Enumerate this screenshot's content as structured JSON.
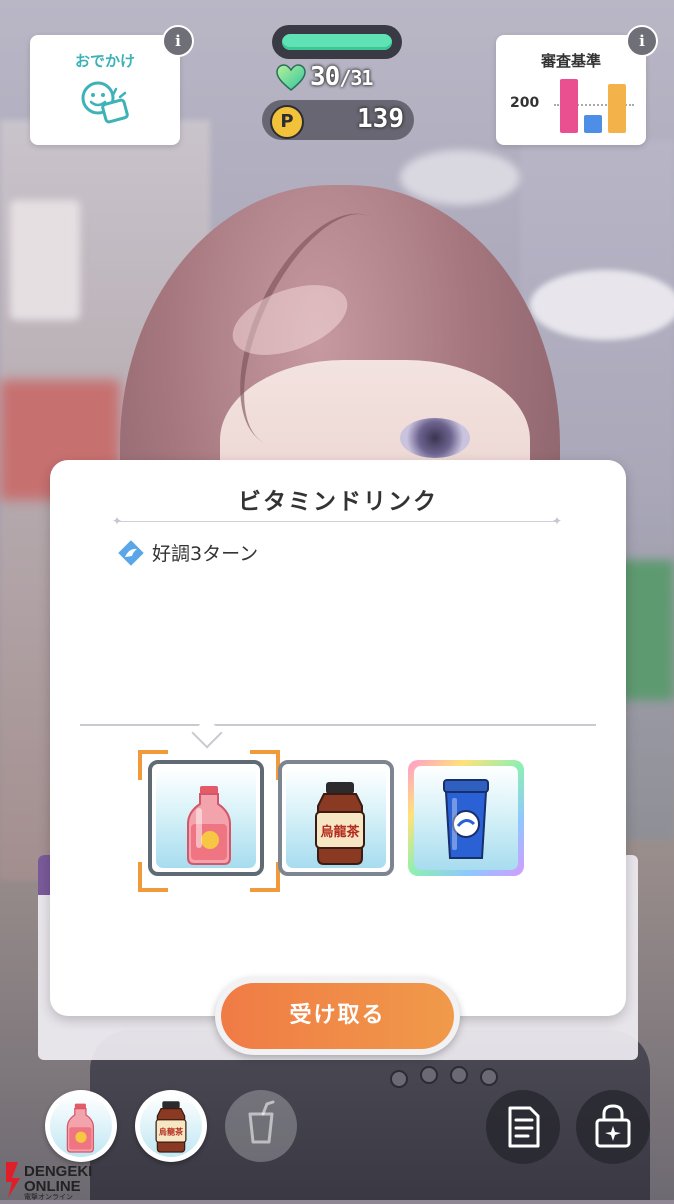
{
  "hud": {
    "outing_label": "おでかけ",
    "outing_icon": "smile-bag-icon",
    "stamina_fraction": 1.0,
    "hp_current": "30",
    "hp_max": "/31",
    "p_label": "P",
    "points": "139",
    "criteria_label": "審査基準",
    "criteria_value": "200",
    "criteria_bars": [
      {
        "value": 0.9,
        "color": "#ea4f8f"
      },
      {
        "value": 0.3,
        "color": "#4d8fe6"
      },
      {
        "value": 0.82,
        "color": "#f4b34a"
      }
    ],
    "info_glyph": "i"
  },
  "dialog": {
    "title": "ビタミンドリンク",
    "effect_icon": "good-condition-icon",
    "effect_text": "好調3ターン",
    "items": [
      {
        "name": "vitamin-drink",
        "icon": "pink-bottle-icon",
        "selected": true
      },
      {
        "name": "oolong-tea",
        "icon": "oolong-tea-bottle-icon",
        "selected": false,
        "label": "烏龍茶"
      },
      {
        "name": "protein-shaker",
        "icon": "blue-shaker-icon",
        "selected": false
      }
    ],
    "receive_label": "受け取る"
  },
  "bottom": {
    "slots": [
      "pink-bottle-icon",
      "oolong-tea-bottle-icon",
      "empty-cup-icon"
    ],
    "slot_tea_label": "烏龍茶",
    "right_buttons": [
      "memo-icon",
      "locked-bag-icon"
    ]
  },
  "watermark": {
    "brand_top": "DENGEKI",
    "brand_bottom": "ONLINE",
    "sub": "電撃オンライン"
  }
}
